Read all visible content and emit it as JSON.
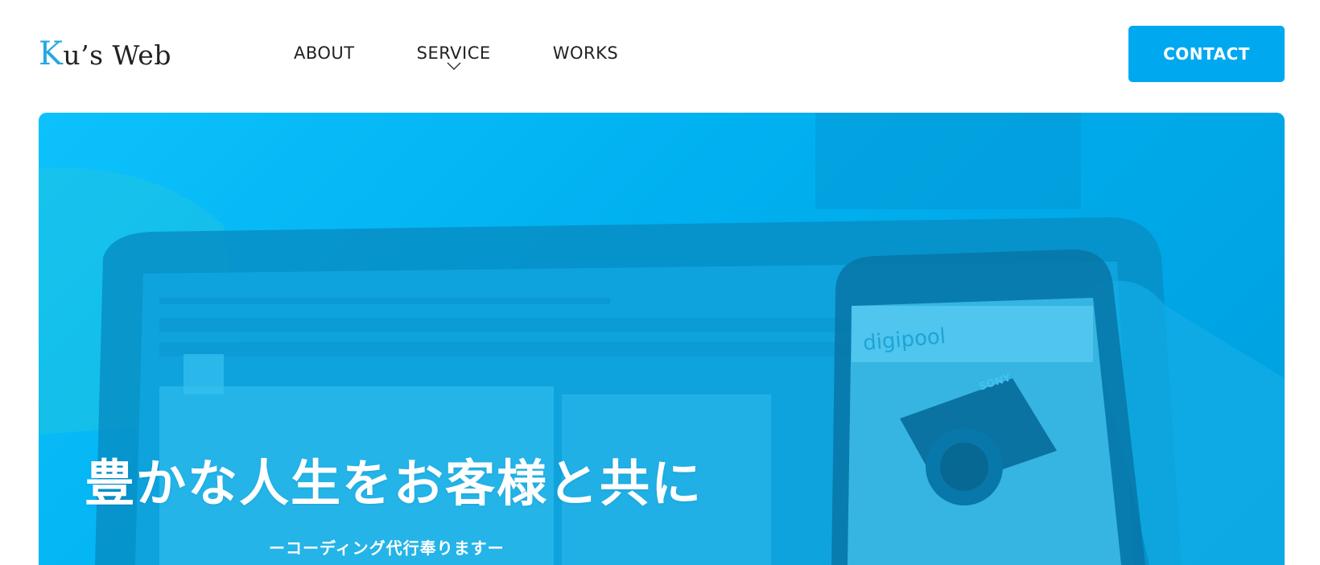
{
  "header": {
    "logo_initial": "K",
    "logo_rest": "u’s Web",
    "nav": [
      {
        "label": "ABOUT"
      },
      {
        "label": "SERVICE"
      },
      {
        "label": "WORKS"
      }
    ],
    "contact_label": "CONTACT"
  },
  "hero": {
    "title": "豊かな人生をお客様と共に",
    "subtitle": "ーコーディング代行奉りますー",
    "phone_screen_text": "digipool",
    "camera_brand": "SONY"
  },
  "colors": {
    "accent": "#00a8f0",
    "logo_initial": "#25a8e0",
    "hero_overlay": "#00adee"
  },
  "icons": {
    "service_dropdown": "chevron-down-icon"
  }
}
